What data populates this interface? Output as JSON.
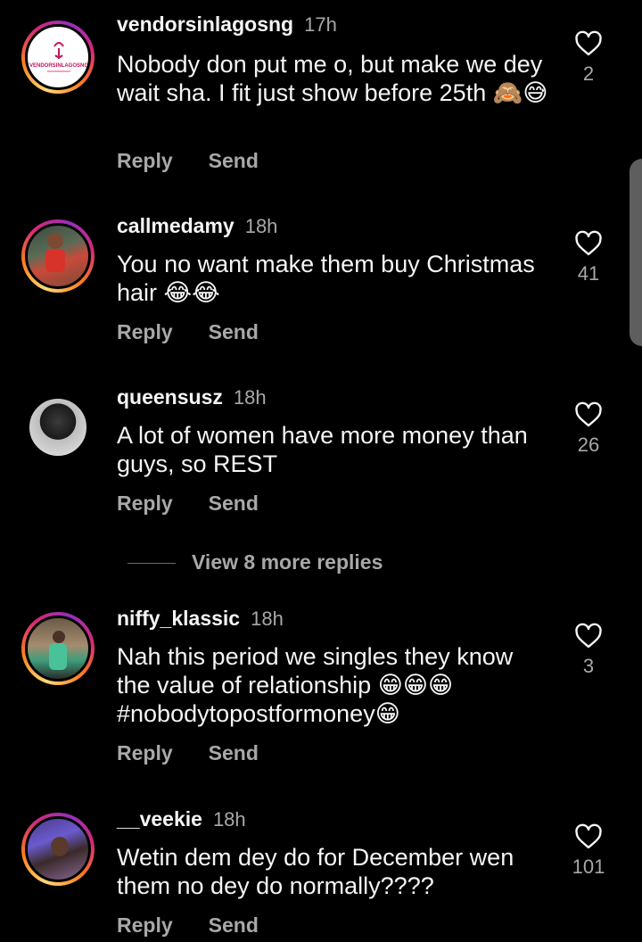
{
  "comments": [
    {
      "username": "vendorsinlagosng",
      "time": "17h",
      "text": "Nobody don put me o, but make we dey wait sha. I fit just show before 25th 🙈😅",
      "likes": "2",
      "avatar_logo": "VENDORSINLAGOSNG",
      "reply": "Reply",
      "send": "Send"
    },
    {
      "username": "callmedamy",
      "time": "18h",
      "text": "You no want make them buy Christmas hair 😂😂",
      "likes": "41",
      "reply": "Reply",
      "send": "Send"
    },
    {
      "username": "queensusz",
      "time": "18h",
      "text": "A lot of women have more money than guys, so REST",
      "likes": "26",
      "reply": "Reply",
      "send": "Send"
    },
    {
      "username": "niffy_klassic",
      "time": "18h",
      "text": "Nah this period we singles they know the value of relationship 😁😁😁 #nobodytopostformoney😁",
      "likes": "3",
      "reply": "Reply",
      "send": "Send"
    },
    {
      "username": "__veekie",
      "time": "18h",
      "text": "Wetin dem dey do for December wen them no dey do normally????",
      "likes": "101",
      "reply": "Reply",
      "send": "Send"
    }
  ],
  "view_more": "View 8 more replies",
  "icons": {
    "like": "heart-outline-icon"
  },
  "colors": {
    "background": "#000000",
    "text": "#f5f5f5",
    "muted": "#a8a8a8"
  }
}
